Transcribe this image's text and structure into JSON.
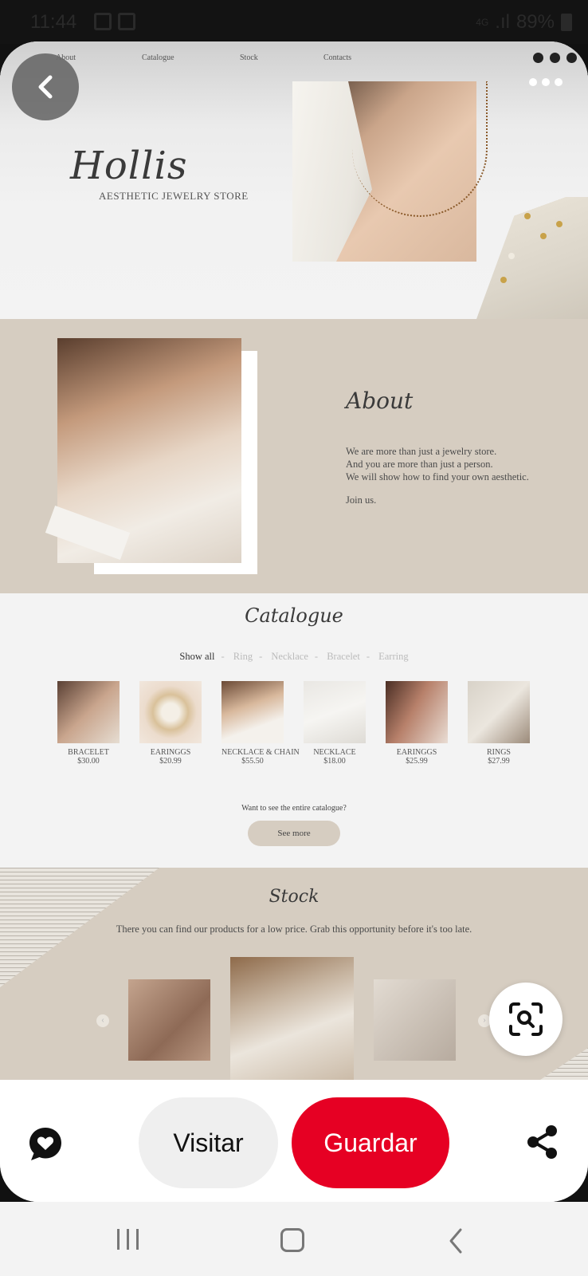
{
  "status_bar": {
    "time": "11:44",
    "battery": "89%",
    "network": "4G"
  },
  "pin": {
    "nav": [
      "About",
      "Catalogue",
      "Stock",
      "Contacts"
    ],
    "brand": {
      "logo": "Hollis",
      "tagline": "AESTHETIC JEWELRY STORE"
    },
    "about": {
      "title": "About",
      "lines": [
        "We are more than just a jewelry store.",
        "And you are more than just a person.",
        "We will show how to find your own aesthetic."
      ],
      "cta": "Join us."
    },
    "catalogue": {
      "title": "Catalogue",
      "filters": [
        "Show all",
        "Ring",
        "Necklace",
        "Bracelet",
        "Earring"
      ],
      "active_filter": "Show all",
      "products": [
        {
          "name": "BRACELET",
          "price": "$30.00"
        },
        {
          "name": "EARINGGS",
          "price": "$20.99"
        },
        {
          "name": "NECKLACE & CHAIN",
          "price": "$55.50"
        },
        {
          "name": "NECKLACE",
          "price": "$18.00"
        },
        {
          "name": "EARINGGS",
          "price": "$25.99"
        },
        {
          "name": "RINGS",
          "price": "$27.99"
        }
      ],
      "prompt": "Want to see the entire catalogue?",
      "button": "See more"
    },
    "stock": {
      "title": "Stock",
      "description": "There you can find our products for a low price. Grab this opportunity before it's too late."
    }
  },
  "actions": {
    "visit": "Visitar",
    "save": "Guardar"
  },
  "icons": {
    "back": "chevron-left-icon",
    "more": "more-dots-icon",
    "lens": "visual-search-icon",
    "chat": "heart-chat-icon",
    "share": "share-icon"
  },
  "colors": {
    "save_button": "#e60023",
    "visit_button": "#efefef",
    "beige": "#d6cdc1"
  }
}
